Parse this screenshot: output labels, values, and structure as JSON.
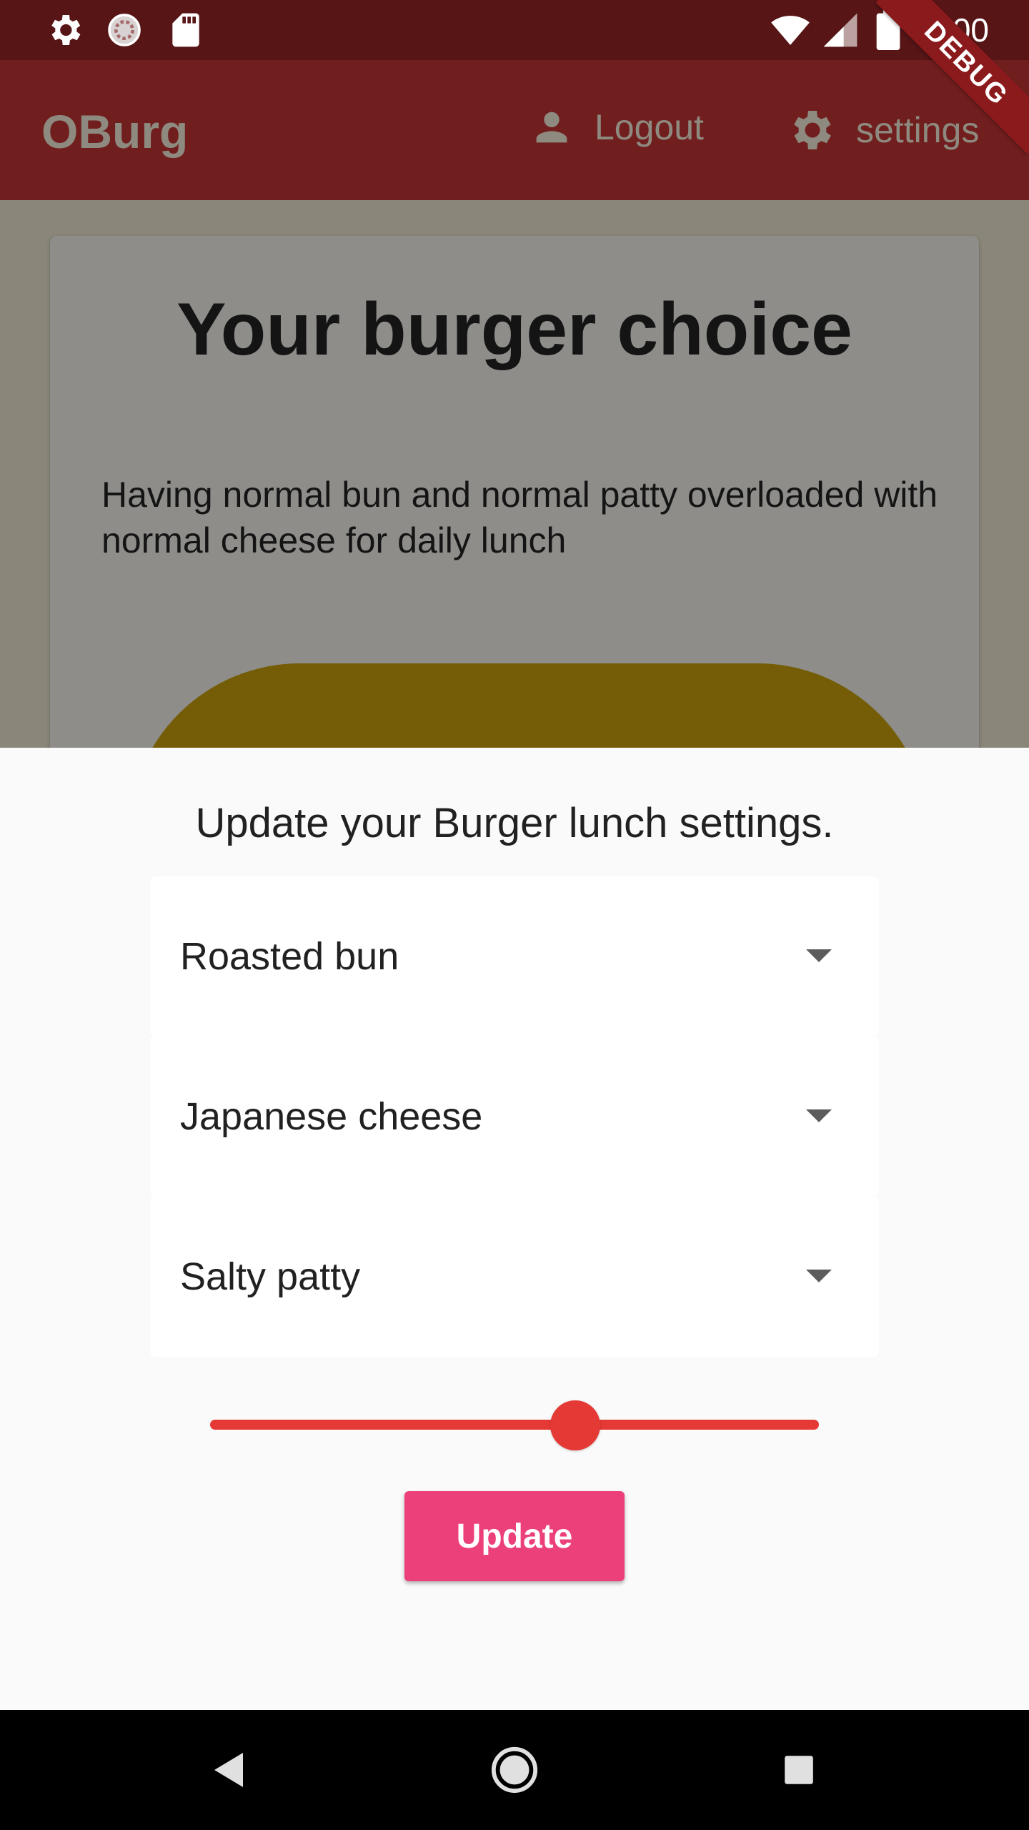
{
  "status_bar": {
    "time": "1:00",
    "icons": [
      "settings-icon",
      "sync-icon",
      "sd-card-icon",
      "wifi-icon",
      "signal-icon",
      "battery-icon"
    ]
  },
  "debug_ribbon": "DEBUG",
  "app_bar": {
    "title": "OBurg",
    "logout_label": "Logout",
    "settings_label": "settings"
  },
  "card": {
    "title": "Your burger choice",
    "description": "Having normal bun  and normal patty overloaded with normal cheese for daily lunch"
  },
  "sheet": {
    "title": "Update your Burger lunch settings.",
    "dropdowns": [
      {
        "value": "Roasted bun"
      },
      {
        "value": "Japanese cheese"
      },
      {
        "value": "Salty patty"
      }
    ],
    "slider": {
      "value_fraction": 0.6
    },
    "update_label": "Update"
  },
  "colors": {
    "accent": "#e53935",
    "button": "#ec407a",
    "app_bar": "#711f1e"
  }
}
